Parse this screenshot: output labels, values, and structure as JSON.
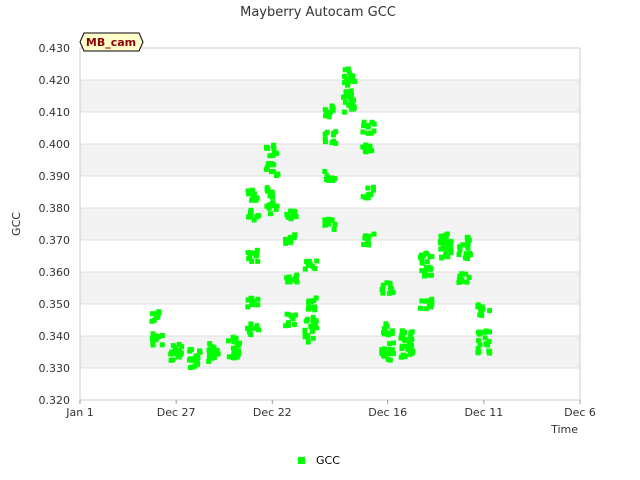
{
  "chart_data": {
    "type": "scatter",
    "title": "Mayberry Autocam GCC",
    "xlabel": "Time",
    "ylabel": "GCC",
    "badge": "MB_cam",
    "x_ticks": [
      "Jan 1",
      "Dec 27",
      "Dec 22",
      "Dec 16",
      "Dec 11",
      "Dec 6"
    ],
    "y_ticks": [
      "0.320",
      "0.330",
      "0.340",
      "0.350",
      "0.360",
      "0.370",
      "0.380",
      "0.390",
      "0.400",
      "0.410",
      "0.420",
      "0.430"
    ],
    "ylim": [
      0.32,
      0.43
    ],
    "x_axis": "days before Jan 1, decreasing to the right (Jan 1 on the left, Dec 6 on the right)",
    "legend": {
      "position": "bottom-center"
    },
    "series": [
      {
        "name": "GCC",
        "color": "#00ff00",
        "marker": "square",
        "points": [
          {
            "date": "Dec 28",
            "gcc": 0.346
          },
          {
            "date": "Dec 28",
            "gcc": 0.339
          },
          {
            "date": "Dec 27",
            "gcc": 0.334
          },
          {
            "date": "Dec 27",
            "gcc": 0.336
          },
          {
            "date": "Dec 26",
            "gcc": 0.332
          },
          {
            "date": "Dec 26",
            "gcc": 0.334
          },
          {
            "date": "Dec 25",
            "gcc": 0.333
          },
          {
            "date": "Dec 25",
            "gcc": 0.336
          },
          {
            "date": "Dec 24",
            "gcc": 0.335
          },
          {
            "date": "Dec 24",
            "gcc": 0.338
          },
          {
            "date": "Dec 23",
            "gcc": 0.342
          },
          {
            "date": "Dec 23",
            "gcc": 0.35
          },
          {
            "date": "Dec 23",
            "gcc": 0.365
          },
          {
            "date": "Dec 23",
            "gcc": 0.378
          },
          {
            "date": "Dec 23",
            "gcc": 0.384
          },
          {
            "date": "Dec 22",
            "gcc": 0.38
          },
          {
            "date": "Dec 22",
            "gcc": 0.392
          },
          {
            "date": "Dec 22",
            "gcc": 0.398
          },
          {
            "date": "Dec 22",
            "gcc": 0.385
          },
          {
            "date": "Dec 21",
            "gcc": 0.378
          },
          {
            "date": "Dec 21",
            "gcc": 0.37
          },
          {
            "date": "Dec 21",
            "gcc": 0.358
          },
          {
            "date": "Dec 21",
            "gcc": 0.345
          },
          {
            "date": "Dec 20",
            "gcc": 0.34
          },
          {
            "date": "Dec 20",
            "gcc": 0.344
          },
          {
            "date": "Dec 20",
            "gcc": 0.35
          },
          {
            "date": "Dec 20",
            "gcc": 0.362
          },
          {
            "date": "Dec 19",
            "gcc": 0.375
          },
          {
            "date": "Dec 19",
            "gcc": 0.39
          },
          {
            "date": "Dec 19",
            "gcc": 0.402
          },
          {
            "date": "Dec 19",
            "gcc": 0.41
          },
          {
            "date": "Dec 18",
            "gcc": 0.418
          },
          {
            "date": "Dec 18",
            "gcc": 0.422
          },
          {
            "date": "Dec 18",
            "gcc": 0.414
          },
          {
            "date": "Dec 18",
            "gcc": 0.411
          },
          {
            "date": "Dec 17",
            "gcc": 0.405
          },
          {
            "date": "Dec 17",
            "gcc": 0.398
          },
          {
            "date": "Dec 17",
            "gcc": 0.385
          },
          {
            "date": "Dec 17",
            "gcc": 0.37
          },
          {
            "date": "Dec 16",
            "gcc": 0.355
          },
          {
            "date": "Dec 16",
            "gcc": 0.342
          },
          {
            "date": "Dec 16",
            "gcc": 0.336
          },
          {
            "date": "Dec 16",
            "gcc": 0.334
          },
          {
            "date": "Dec 15",
            "gcc": 0.335
          },
          {
            "date": "Dec 15",
            "gcc": 0.337
          },
          {
            "date": "Dec 15",
            "gcc": 0.34
          },
          {
            "date": "Dec 14",
            "gcc": 0.35
          },
          {
            "date": "Dec 14",
            "gcc": 0.36
          },
          {
            "date": "Dec 14",
            "gcc": 0.364
          },
          {
            "date": "Dec 13",
            "gcc": 0.366
          },
          {
            "date": "Dec 13",
            "gcc": 0.368
          },
          {
            "date": "Dec 13",
            "gcc": 0.37
          },
          {
            "date": "Dec 12",
            "gcc": 0.369
          },
          {
            "date": "Dec 12",
            "gcc": 0.366
          },
          {
            "date": "Dec 12",
            "gcc": 0.358
          },
          {
            "date": "Dec 11",
            "gcc": 0.348
          },
          {
            "date": "Dec 11",
            "gcc": 0.34
          },
          {
            "date": "Dec 11",
            "gcc": 0.336
          }
        ]
      }
    ]
  }
}
